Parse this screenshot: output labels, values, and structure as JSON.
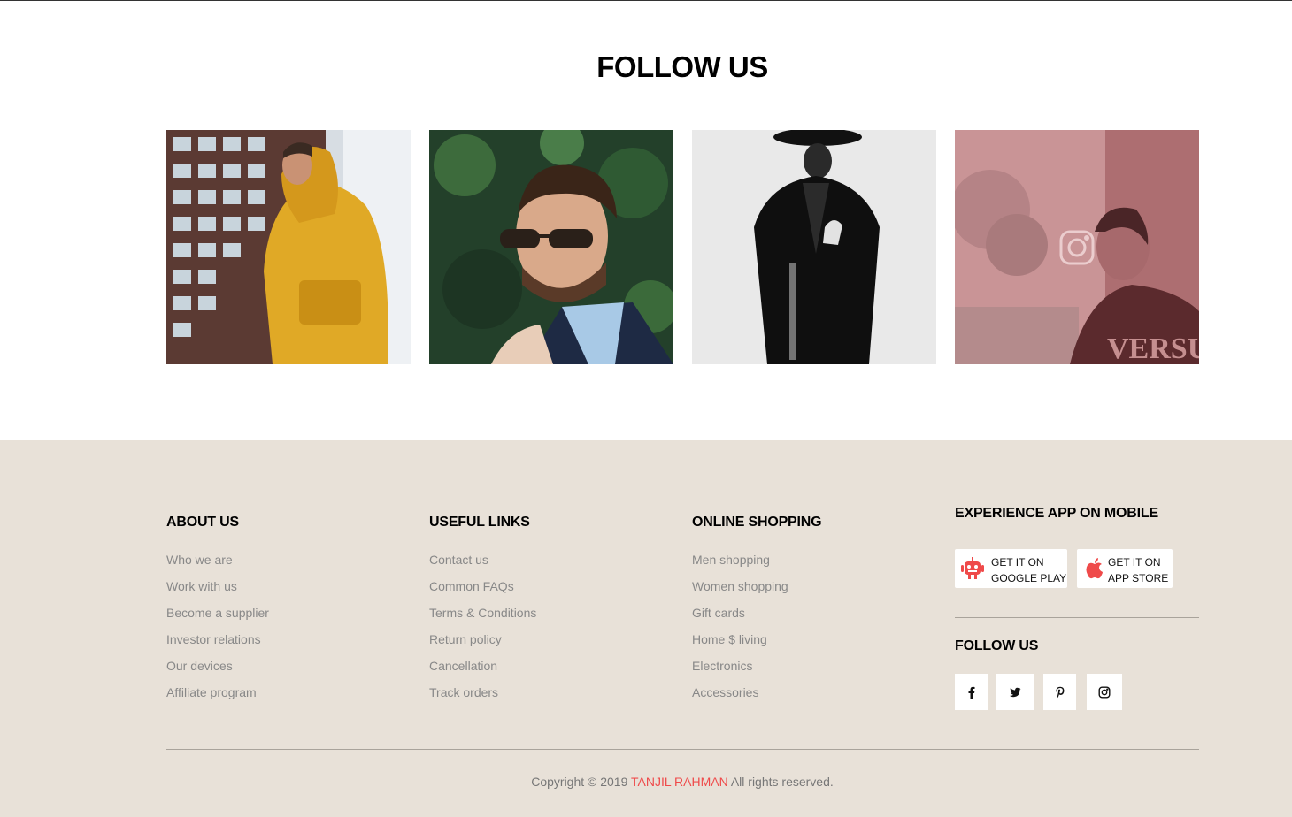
{
  "follow_section": {
    "title": "FOLLOW US",
    "photos": [
      {
        "name": "yellow-hoodie-photo"
      },
      {
        "name": "sunglasses-photo"
      },
      {
        "name": "black-coat-photo"
      },
      {
        "name": "versus-tshirt-photo",
        "overlay_icon": "instagram-icon",
        "overlay_color": "#d9979a"
      }
    ]
  },
  "footer": {
    "background": "#e8e1d8",
    "about": {
      "title": "ABOUT US",
      "links": [
        "Who we are",
        "Work with us",
        "Become a supplier",
        "Investor relations",
        "Our devices",
        "Affiliate program"
      ]
    },
    "useful": {
      "title": "USEFUL LINKS",
      "links": [
        "Contact us",
        "Common FAQs",
        "Terms & Conditions",
        "Return policy",
        "Cancellation",
        "Track orders"
      ]
    },
    "shopping": {
      "title": "ONLINE SHOPPING",
      "links": [
        "Men shopping",
        "Women shopping",
        "Gift cards",
        "Home $ living",
        "Electronics",
        "Accessories"
      ]
    },
    "app": {
      "title": "EXPERIENCE APP ON MOBILE",
      "google": {
        "line1": "GET IT ON",
        "line2": "GOOGLE PLAY",
        "icon": "android-icon"
      },
      "apple": {
        "line1": "GET IT ON",
        "line2": "APP STORE",
        "icon": "apple-icon"
      },
      "icon_color": "#ef4a4a"
    },
    "follow": {
      "title": "FOLLOW US",
      "icons": [
        "facebook-icon",
        "twitter-icon",
        "pinterest-icon",
        "instagram-icon"
      ]
    },
    "copyright": {
      "prefix": "Copyright © 2019",
      "author": "TANJIL RAHMAN",
      "suffix": "All rights reserved.",
      "author_color": "#ef4a4a"
    }
  }
}
